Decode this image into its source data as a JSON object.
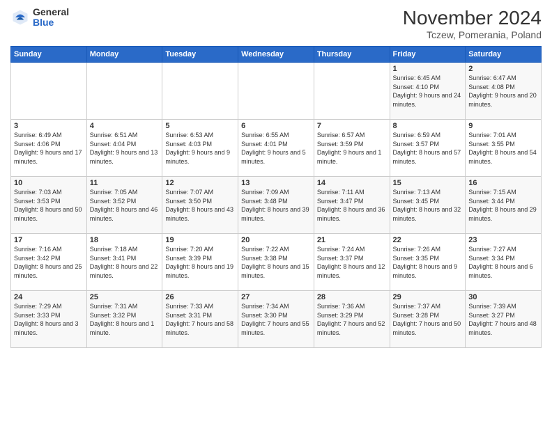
{
  "logo": {
    "general": "General",
    "blue": "Blue"
  },
  "title": "November 2024",
  "subtitle": "Tczew, Pomerania, Poland",
  "weekdays": [
    "Sunday",
    "Monday",
    "Tuesday",
    "Wednesday",
    "Thursday",
    "Friday",
    "Saturday"
  ],
  "weeks": [
    [
      {
        "day": "",
        "info": ""
      },
      {
        "day": "",
        "info": ""
      },
      {
        "day": "",
        "info": ""
      },
      {
        "day": "",
        "info": ""
      },
      {
        "day": "",
        "info": ""
      },
      {
        "day": "1",
        "info": "Sunrise: 6:45 AM\nSunset: 4:10 PM\nDaylight: 9 hours and 24 minutes."
      },
      {
        "day": "2",
        "info": "Sunrise: 6:47 AM\nSunset: 4:08 PM\nDaylight: 9 hours and 20 minutes."
      }
    ],
    [
      {
        "day": "3",
        "info": "Sunrise: 6:49 AM\nSunset: 4:06 PM\nDaylight: 9 hours and 17 minutes."
      },
      {
        "day": "4",
        "info": "Sunrise: 6:51 AM\nSunset: 4:04 PM\nDaylight: 9 hours and 13 minutes."
      },
      {
        "day": "5",
        "info": "Sunrise: 6:53 AM\nSunset: 4:03 PM\nDaylight: 9 hours and 9 minutes."
      },
      {
        "day": "6",
        "info": "Sunrise: 6:55 AM\nSunset: 4:01 PM\nDaylight: 9 hours and 5 minutes."
      },
      {
        "day": "7",
        "info": "Sunrise: 6:57 AM\nSunset: 3:59 PM\nDaylight: 9 hours and 1 minute."
      },
      {
        "day": "8",
        "info": "Sunrise: 6:59 AM\nSunset: 3:57 PM\nDaylight: 8 hours and 57 minutes."
      },
      {
        "day": "9",
        "info": "Sunrise: 7:01 AM\nSunset: 3:55 PM\nDaylight: 8 hours and 54 minutes."
      }
    ],
    [
      {
        "day": "10",
        "info": "Sunrise: 7:03 AM\nSunset: 3:53 PM\nDaylight: 8 hours and 50 minutes."
      },
      {
        "day": "11",
        "info": "Sunrise: 7:05 AM\nSunset: 3:52 PM\nDaylight: 8 hours and 46 minutes."
      },
      {
        "day": "12",
        "info": "Sunrise: 7:07 AM\nSunset: 3:50 PM\nDaylight: 8 hours and 43 minutes."
      },
      {
        "day": "13",
        "info": "Sunrise: 7:09 AM\nSunset: 3:48 PM\nDaylight: 8 hours and 39 minutes."
      },
      {
        "day": "14",
        "info": "Sunrise: 7:11 AM\nSunset: 3:47 PM\nDaylight: 8 hours and 36 minutes."
      },
      {
        "day": "15",
        "info": "Sunrise: 7:13 AM\nSunset: 3:45 PM\nDaylight: 8 hours and 32 minutes."
      },
      {
        "day": "16",
        "info": "Sunrise: 7:15 AM\nSunset: 3:44 PM\nDaylight: 8 hours and 29 minutes."
      }
    ],
    [
      {
        "day": "17",
        "info": "Sunrise: 7:16 AM\nSunset: 3:42 PM\nDaylight: 8 hours and 25 minutes."
      },
      {
        "day": "18",
        "info": "Sunrise: 7:18 AM\nSunset: 3:41 PM\nDaylight: 8 hours and 22 minutes."
      },
      {
        "day": "19",
        "info": "Sunrise: 7:20 AM\nSunset: 3:39 PM\nDaylight: 8 hours and 19 minutes."
      },
      {
        "day": "20",
        "info": "Sunrise: 7:22 AM\nSunset: 3:38 PM\nDaylight: 8 hours and 15 minutes."
      },
      {
        "day": "21",
        "info": "Sunrise: 7:24 AM\nSunset: 3:37 PM\nDaylight: 8 hours and 12 minutes."
      },
      {
        "day": "22",
        "info": "Sunrise: 7:26 AM\nSunset: 3:35 PM\nDaylight: 8 hours and 9 minutes."
      },
      {
        "day": "23",
        "info": "Sunrise: 7:27 AM\nSunset: 3:34 PM\nDaylight: 8 hours and 6 minutes."
      }
    ],
    [
      {
        "day": "24",
        "info": "Sunrise: 7:29 AM\nSunset: 3:33 PM\nDaylight: 8 hours and 3 minutes."
      },
      {
        "day": "25",
        "info": "Sunrise: 7:31 AM\nSunset: 3:32 PM\nDaylight: 8 hours and 1 minute."
      },
      {
        "day": "26",
        "info": "Sunrise: 7:33 AM\nSunset: 3:31 PM\nDaylight: 7 hours and 58 minutes."
      },
      {
        "day": "27",
        "info": "Sunrise: 7:34 AM\nSunset: 3:30 PM\nDaylight: 7 hours and 55 minutes."
      },
      {
        "day": "28",
        "info": "Sunrise: 7:36 AM\nSunset: 3:29 PM\nDaylight: 7 hours and 52 minutes."
      },
      {
        "day": "29",
        "info": "Sunrise: 7:37 AM\nSunset: 3:28 PM\nDaylight: 7 hours and 50 minutes."
      },
      {
        "day": "30",
        "info": "Sunrise: 7:39 AM\nSunset: 3:27 PM\nDaylight: 7 hours and 48 minutes."
      }
    ]
  ]
}
